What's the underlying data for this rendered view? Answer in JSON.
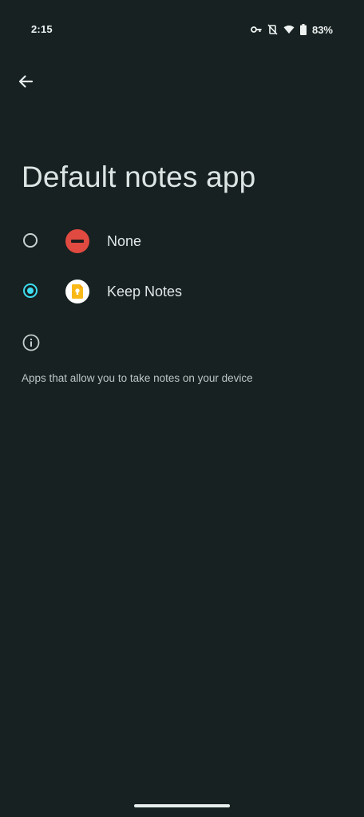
{
  "status_bar": {
    "time": "2:15",
    "battery_percent": "83%",
    "icons": [
      "vpn-key-icon",
      "vibrate-off-icon",
      "wifi-icon",
      "battery-icon"
    ]
  },
  "toolbar": {
    "back_icon": "arrow-back-icon"
  },
  "page": {
    "title": "Default notes app"
  },
  "options": [
    {
      "label": "None",
      "icon": "none-icon",
      "selected": false
    },
    {
      "label": "Keep Notes",
      "icon": "keep-notes-icon",
      "selected": true
    }
  ],
  "info": {
    "icon": "info-icon",
    "description": "Apps that allow you to take notes on your device"
  },
  "colors": {
    "background": "#172121",
    "accent": "#3ddcf0",
    "none_icon_red": "#e04a40",
    "keep_yellow": "#f9b918"
  }
}
